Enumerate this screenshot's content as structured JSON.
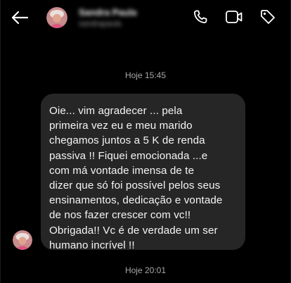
{
  "header": {
    "contact_name": "Sandra Paula",
    "contact_subtitle": "sandrapaula",
    "icons": [
      "back-arrow-icon",
      "phone-icon",
      "video-camera-icon",
      "tag-icon"
    ]
  },
  "thread": {
    "timestamp_top": "Hoje 15:45",
    "message": "Oie... vim agradecer ... pela\nprimeira vez eu e meu marido\nchegamos juntos a 5 K de renda\npassiva !! Fiquei emocionada ...e\ncom má vontade imensa de te\ndizer que só foi possível pelos seus\nensinamentos, dedicação e vontade\nde nos fazer crescer com vc!!\nObrigada!! Vc é de verdade um ser\nhumano incrível !!",
    "timestamp_bottom": "Hoje 20:01"
  },
  "colors": {
    "background": "#000000",
    "bubble": "#262626",
    "text": "#f5f5f5",
    "muted": "#a8a8a8"
  }
}
